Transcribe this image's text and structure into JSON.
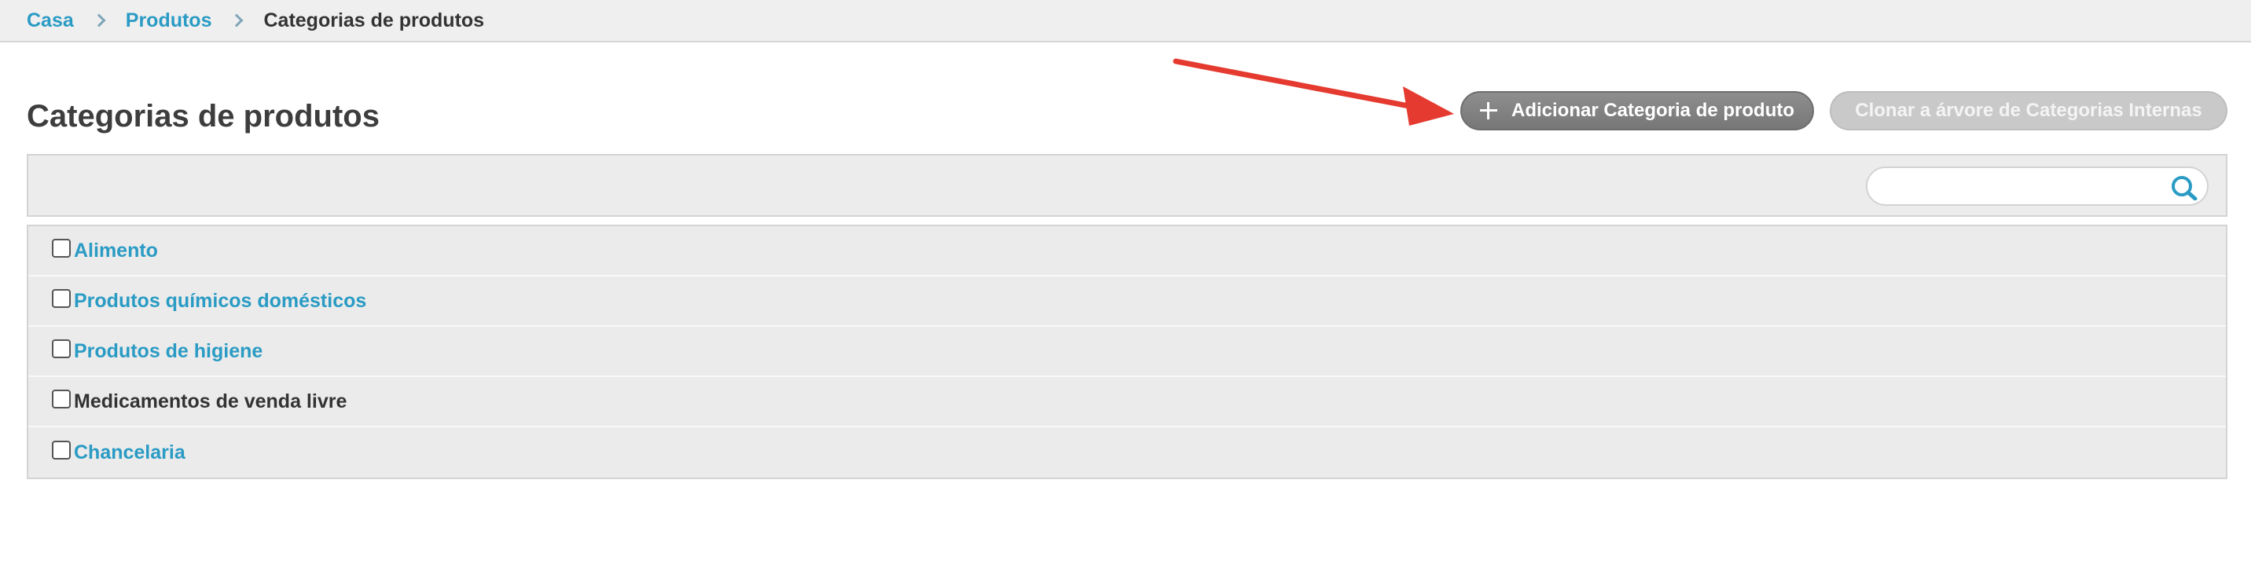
{
  "breadcrumb": {
    "items": [
      {
        "label": "Casa",
        "link": true
      },
      {
        "label": "Produtos",
        "link": true
      },
      {
        "label": "Categorias de produtos",
        "link": false
      }
    ]
  },
  "page": {
    "title": "Categorias de produtos"
  },
  "actions": {
    "add_label": "Adicionar Categoria de produto",
    "clone_label": "Clonar a árvore de Categorias Internas"
  },
  "search": {
    "value": "",
    "placeholder": ""
  },
  "categories": [
    {
      "label": "Alimento",
      "link": true
    },
    {
      "label": "Produtos químicos domésticos",
      "link": true
    },
    {
      "label": "Produtos de higiene",
      "link": true
    },
    {
      "label": "Medicamentos de venda livre",
      "link": false
    },
    {
      "label": "Chancelaria",
      "link": true
    }
  ],
  "colors": {
    "accent": "#2a9bc4",
    "annotation_arrow": "#e53a2f",
    "add_button": "#808080",
    "clone_button_disabled": "#c9c9c9"
  },
  "icons": {
    "add_button": "plus-icon",
    "search": "search-icon",
    "breadcrumb_separator": "chevron-right-icon"
  }
}
